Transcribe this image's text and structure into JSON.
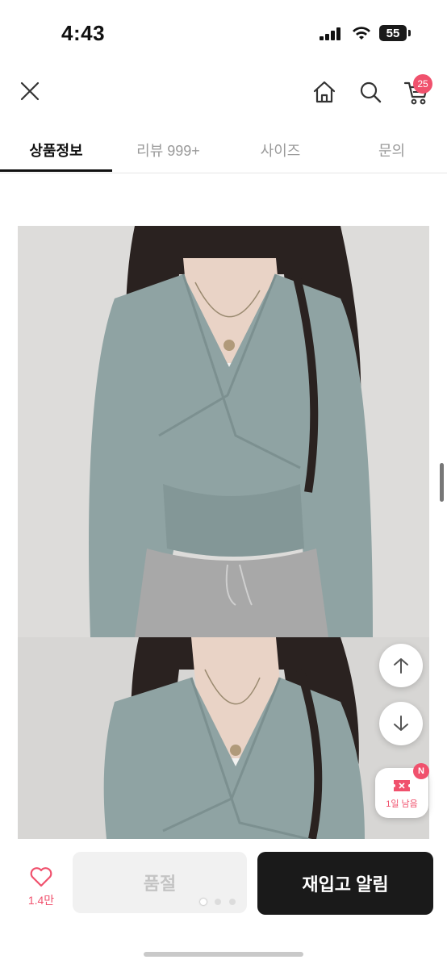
{
  "status_bar": {
    "time": "4:43",
    "battery": "55"
  },
  "header": {
    "cart_badge": "25"
  },
  "tabs": [
    {
      "label": "상품정보",
      "active": true
    },
    {
      "label": "리뷰 999+",
      "active": false
    },
    {
      "label": "사이즈",
      "active": false
    },
    {
      "label": "문의",
      "active": false
    }
  ],
  "product_images": [
    {
      "alt": "product-photo-1",
      "sweater_color": "#8fa3a3",
      "pants_color": "#a8a8a8"
    },
    {
      "alt": "product-photo-2",
      "sweater_color": "#8fa3a3"
    }
  ],
  "floating": {
    "coupon_label": "1일 남음",
    "coupon_badge": "N"
  },
  "bottom_bar": {
    "like_count": "1.4만",
    "soldout_label": "품절",
    "restock_label": "재입고 알림"
  },
  "colors": {
    "accent": "#f0516d",
    "dark_button": "#1a1a1a"
  }
}
